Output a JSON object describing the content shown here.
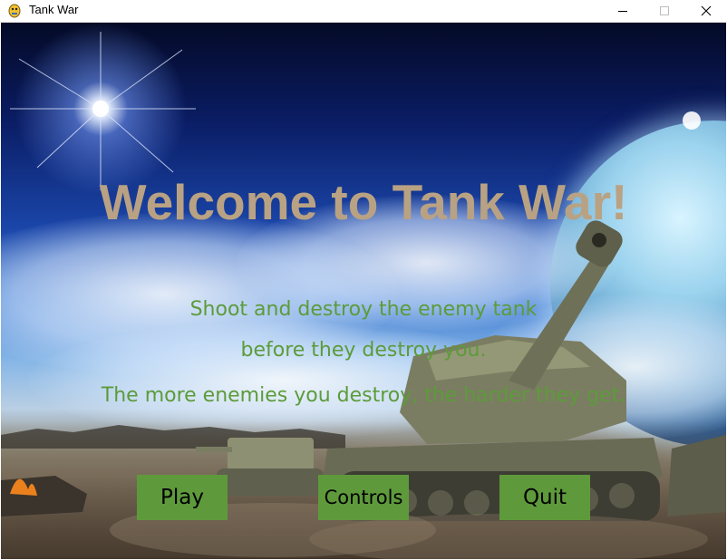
{
  "window": {
    "title": "Tank War",
    "icons": {
      "app": "pygame-snake-icon",
      "minimize": "minimize-icon",
      "maximize": "maximize-icon",
      "close": "close-icon"
    }
  },
  "game": {
    "headline": "Welcome to Tank War!",
    "lines": [
      "Shoot and destroy the enemy tank",
      "before they destroy you.",
      "The more enemies you destroy, the harder they get."
    ],
    "buttons": {
      "play": "Play",
      "controls": "Controls",
      "quit": "Quit"
    }
  },
  "colors": {
    "headline": "#b9a283",
    "body_text": "#5c9b3a",
    "button_bg": "#5e9a3b",
    "button_text": "#000000"
  }
}
